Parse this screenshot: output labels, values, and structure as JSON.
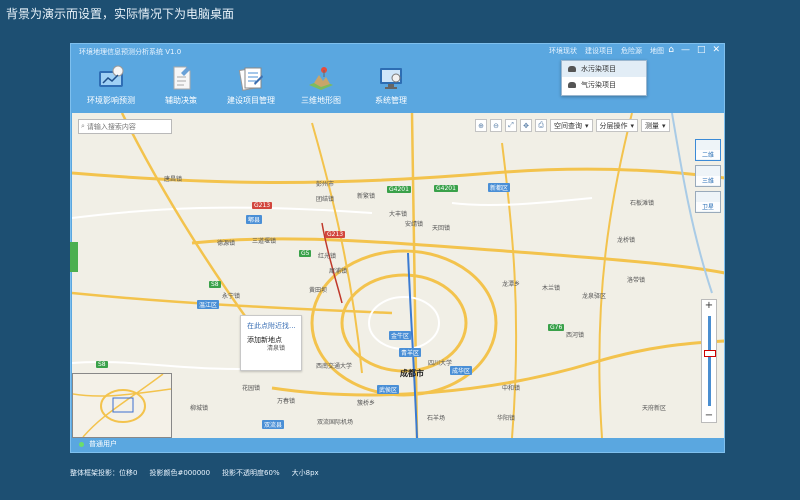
{
  "desktop": {
    "note": "背景为演示而设置，实际情况下为电脑桌面",
    "bottom_info": [
      "整体框架投影：位移0",
      "投影颜色#000000",
      "投影不透明度60%",
      "大小8px"
    ]
  },
  "window": {
    "title": "环境地理信息预测分析系统 V1.0",
    "top_links": [
      "环境现状",
      "建设项目",
      "危险源",
      "地图"
    ],
    "controls": {
      "home": "⌂",
      "minimize": "—",
      "maximize": "□",
      "close": "✕"
    }
  },
  "toolbar": {
    "items": [
      {
        "label": "环境影响预测",
        "icon": "prediction-icon"
      },
      {
        "label": "辅助决策",
        "icon": "decision-icon"
      },
      {
        "label": "建设项目管理",
        "icon": "project-icon"
      },
      {
        "label": "三维地形图",
        "icon": "terrain-icon"
      },
      {
        "label": "系统管理",
        "icon": "system-icon"
      }
    ]
  },
  "dropdown": {
    "items": [
      {
        "label": "水污染项目",
        "active": true
      },
      {
        "label": "气污染项目",
        "active": false
      }
    ]
  },
  "map": {
    "search_placeholder": "请输入搜索内容",
    "tools": {
      "spatial_query": "空间查询",
      "layer_ops": "分层操作",
      "measure": "测量"
    },
    "map_types": [
      "二维",
      "三维",
      "卫星"
    ],
    "zoom": {
      "plus": "+",
      "minus": "−"
    },
    "popup": {
      "line1": "在此点附近找...",
      "line2": "添加新地点"
    },
    "city_label": "成都市",
    "places": [
      "新都区",
      "郫县",
      "双流县",
      "温江区",
      "武侯区",
      "青羊区",
      "成华区",
      "金牛区",
      "龙泉驿区",
      "彭州市",
      "新繁镇",
      "团结镇",
      "犀浦镇",
      "唐昌镇",
      "安靖镇",
      "永宁镇",
      "红光镇",
      "德源镇",
      "三道堰镇",
      "石板滩镇",
      "大丰镇",
      "天回镇",
      "龙潭乡",
      "洛带镇",
      "西河镇",
      "黄田坝",
      "簇桥乡",
      "石羊场",
      "中和镇",
      "华阳镇",
      "万春镇",
      "花园镇",
      "柳城镇",
      "清泉镇",
      "天府新区",
      "四川大学",
      "西南交通大学",
      "木兰镇",
      "龙桥镇",
      "双流国际机场"
    ],
    "highways": [
      "G4201",
      "G4201",
      "G5",
      "G213",
      "G213",
      "S8",
      "S8",
      "G76"
    ]
  },
  "status": {
    "user": "普通用户"
  }
}
